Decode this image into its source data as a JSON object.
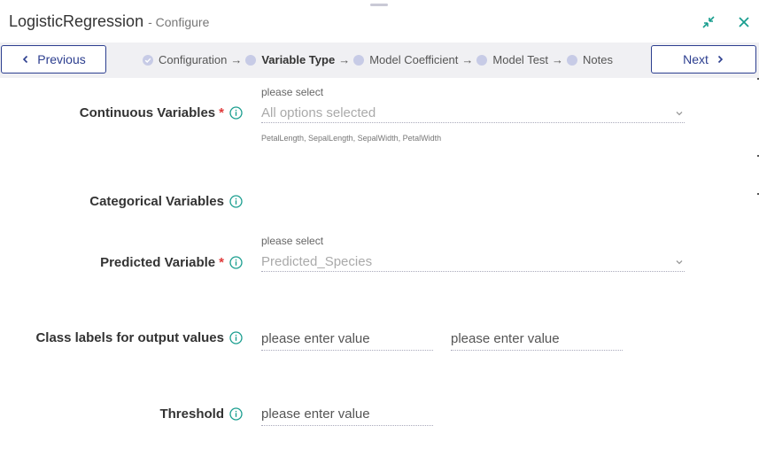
{
  "header": {
    "title": "LogisticRegression",
    "subtitle": "- Configure",
    "icons": [
      "minimize-icon",
      "close-icon"
    ],
    "accent_color": "#1a9e8f"
  },
  "stepbar": {
    "previous_label": "Previous",
    "next_label": "Next",
    "steps": [
      {
        "label": "Configuration",
        "status": "done"
      },
      {
        "label": "Variable Type",
        "status": "active"
      },
      {
        "label": "Model Coefficient",
        "status": "pending"
      },
      {
        "label": "Model Test",
        "status": "pending"
      },
      {
        "label": "Notes",
        "status": "pending"
      }
    ],
    "arrow": "→"
  },
  "form": {
    "continuous": {
      "label": "Continuous Variables",
      "required": "*",
      "hint": "please select",
      "value": "All options selected",
      "summary": "PetalLength, SepalLength, SepalWidth, PetalWidth"
    },
    "categorical": {
      "label": "Categorical Variables"
    },
    "predicted": {
      "label": "Predicted Variable",
      "required": "*",
      "hint": "please select",
      "value": "Predicted_Species"
    },
    "class_labels": {
      "label": "Class labels for output values",
      "placeholder_1": "please enter value",
      "placeholder_2": "please enter value"
    },
    "threshold": {
      "label": "Threshold",
      "placeholder": "please enter value"
    }
  }
}
